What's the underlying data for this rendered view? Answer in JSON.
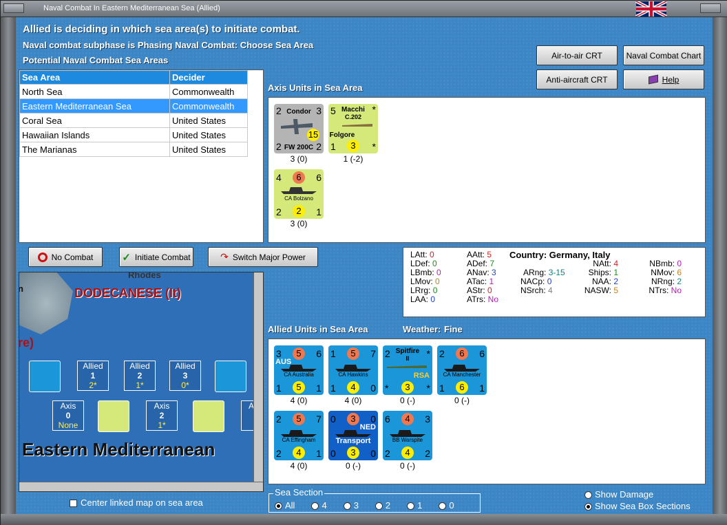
{
  "window": {
    "title": "Naval Combat In Eastern Mediterranean Sea (Allied)"
  },
  "headings": {
    "status": "Allied is deciding in which sea area(s) to initiate combat.",
    "subphase": "Naval combat subphase is Phasing Naval Combat: Choose Sea Area",
    "potential": "Potential Naval Combat Sea Areas",
    "axis_units": "Axis Units in Sea Area",
    "allied_units": "Allied Units in Sea Area",
    "weather_label": "Weather:",
    "weather_value": "Fine"
  },
  "buttons": {
    "air_to_air": "Air-to-air CRT",
    "naval_chart": "Naval Combat Chart",
    "anti_aircraft": "Anti-aircraft CRT",
    "help": "Help",
    "no_combat": "No Combat",
    "initiate": "Initiate Combat",
    "switch": "Switch Major Power"
  },
  "sea_table": {
    "headers": [
      "Sea Area",
      "Decider"
    ],
    "rows": [
      [
        "North Sea",
        "Commonwealth"
      ],
      [
        "Eastern Mediterranean Sea",
        "Commonwealth"
      ],
      [
        "Coral Sea",
        "United States"
      ],
      [
        "Hawaiian Islands",
        "United States"
      ],
      [
        "The Marianas",
        "United States"
      ]
    ]
  },
  "axis_units": [
    {
      "tl": "2",
      "tr": "3",
      "bl": "2",
      "br": "2",
      "center": "15",
      "title": "Condor",
      "sub": "FW 200C",
      "caption": "3 (0)"
    },
    {
      "tl": "5",
      "tr": "*",
      "bl": "1",
      "br": "*",
      "center": "3",
      "title": "Macchi",
      "sub": "C.202",
      "sub2": "Folgore",
      "caption": "1 (-2)"
    },
    {
      "tl": "4",
      "top": "6",
      "tr": "6",
      "bl": "2",
      "center": "2",
      "br": "1",
      "title": "CA Bolzano",
      "caption": "3 (0)"
    }
  ],
  "allied_units": [
    {
      "tl": "3",
      "top": "5",
      "tr": "6",
      "bl": "1",
      "center": "5",
      "br": "1",
      "title": "CA Australia",
      "tag": "AUS",
      "caption": "4 (0)"
    },
    {
      "tl": "1",
      "top": "5",
      "tr": "7",
      "bl": "1",
      "center": "4",
      "br": "0",
      "title": "CA Hawkins",
      "caption": "4 (0)"
    },
    {
      "tl": "2",
      "tr": "*",
      "bl": "*",
      "center": "3",
      "br": "*",
      "title": "Spitfire",
      "sub": "II",
      "tag": "RSA",
      "caption": "0 (-)"
    },
    {
      "tl": "2",
      "top": "6",
      "tr": "6",
      "bl": "1",
      "center": "6",
      "br": "1",
      "title": "CA Manchester",
      "caption": "0 (-)"
    },
    {
      "tl": "2",
      "top": "5",
      "tr": "7",
      "bl": "2",
      "center": "4",
      "br": "1",
      "title": "CA Effingham",
      "caption": "4 (0)"
    },
    {
      "tl": "0",
      "top": "3",
      "tr": "0",
      "bl": "0",
      "center": "3",
      "br": "0",
      "title": "Transport",
      "tag": "NED",
      "caption": "0 (-)"
    },
    {
      "tl": "6",
      "top": "4",
      "tr": "3",
      "bl": "2",
      "center": "4",
      "br": "2",
      "title": "BB Warspite",
      "caption": "0 (-)"
    }
  ],
  "stats": {
    "country_label": "Country:",
    "country_value": "Germany, Italy",
    "col1": [
      [
        "LAtt:",
        "0"
      ],
      [
        "LDef:",
        "0"
      ],
      [
        "LBmb:",
        "0"
      ],
      [
        "LMov:",
        "0"
      ],
      [
        "LRrg:",
        "0"
      ],
      [
        "LAA:",
        "0"
      ]
    ],
    "col2": [
      [
        "AAtt:",
        "5"
      ],
      [
        "ADef:",
        "7"
      ],
      [
        "ANav:",
        "3"
      ],
      [
        "ATac:",
        "1"
      ],
      [
        "AStr:",
        "0"
      ],
      [
        "ATrs:",
        "No"
      ]
    ],
    "col3": [
      [
        "ARng:",
        "3-15"
      ],
      [
        "NACp:",
        "0"
      ],
      [
        "NSrch:",
        "4"
      ]
    ],
    "col4": [
      [
        "NAtt:",
        "4"
      ],
      [
        "Ships:",
        "1"
      ],
      [
        "NAA:",
        "2"
      ],
      [
        "NASW:",
        "5"
      ]
    ],
    "col5": [
      [
        "NBmb:",
        "0"
      ],
      [
        "NMov:",
        "6"
      ],
      [
        "NRng:",
        "2"
      ],
      [
        "NTrs:",
        "No"
      ]
    ]
  },
  "map": {
    "island_label": "Rhodes",
    "region_label": "DODECANESE (It)",
    "partial_label": "re)",
    "partial_n": "n",
    "sea_name": "Eastern Mediterranean",
    "allied_boxes": [
      [
        "Allied",
        "1",
        "2*"
      ],
      [
        "Allied",
        "2",
        "1*"
      ],
      [
        "Allied",
        "3",
        "0*"
      ]
    ],
    "axis_boxes": [
      [
        "Axis",
        "0",
        "None"
      ],
      [
        "Axis",
        "2",
        "1*"
      ]
    ],
    "axis_partial": "A",
    "center_linked": "Center linked map on sea area"
  },
  "sea_section": {
    "label": "Sea Section",
    "options": [
      "All",
      "4",
      "3",
      "2",
      "1",
      "0"
    ],
    "selected": "All"
  },
  "view_options": {
    "show_damage": "Show Damage",
    "show_boxes": "Show Sea Box Sections"
  },
  "colors": {
    "panel_blue": "#3c86c6",
    "axis_grey": "#b4b4b4",
    "axis_green": "#d5e87a",
    "allied_blue": "#1b96d8",
    "transport_blue": "#1160c8",
    "table_header": "#1d8ae0",
    "selected_row": "#3399ff"
  }
}
